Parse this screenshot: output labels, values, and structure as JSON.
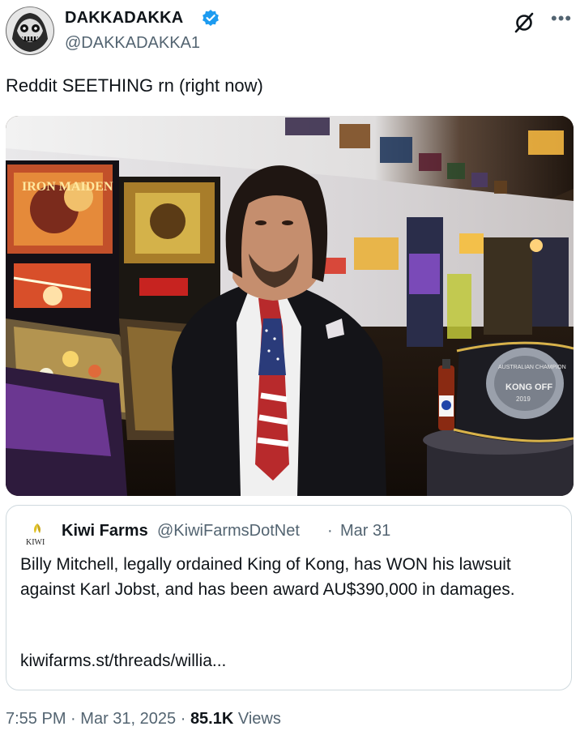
{
  "tweet": {
    "author": {
      "display_name": "DAKKADAKKA",
      "handle": "@DAKKADAKKA1",
      "verified": true
    },
    "text": "Reddit SEETHING rn (right now)",
    "more_icon": "more-horizontal-icon",
    "grok_icon": "grok-icon"
  },
  "quote": {
    "author_name": "Kiwi Farms",
    "handle": "@KiwiFarmsDotNet",
    "separator": "·",
    "date": "Mar 31",
    "avatar_text": "KIWI",
    "text": "Billy Mitchell, legally ordained King of Kong, has WON his lawsuit against Karl Jobst, and has been award AU$390,000 in damages.",
    "link": "kiwifarms.st/threads/willia..."
  },
  "photo": {
    "marquee_text": "IRON MAIDEN",
    "belt_text": "KONG OFF",
    "belt_ring_text": "AUSTRALIAN CHAMPION",
    "belt_year": "2019"
  },
  "meta": {
    "time": "7:55 PM",
    "date": "Mar 31, 2025",
    "separator": "·",
    "views_count": "85.1K",
    "views_label": "Views"
  },
  "colors": {
    "verified": "#1d9bf0",
    "secondary_text": "#536471",
    "border": "#cfd9de"
  }
}
